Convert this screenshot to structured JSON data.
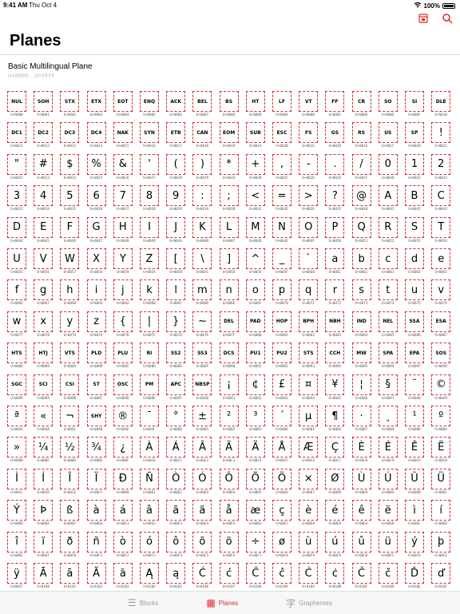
{
  "status": {
    "time": "9:41 AM",
    "date": "Thu Oct 4",
    "battery": "100%"
  },
  "icons": {
    "wifi": "wifi-icon",
    "battery": "battery-icon",
    "bookmark": "bookmark-icon",
    "search": "search-icon",
    "blocks": "blocks-icon",
    "planes": "planes-icon",
    "graphemes": "graphemes-icon"
  },
  "colors": {
    "accent": "#e0282d",
    "dash": "#d52a2a"
  },
  "header": {
    "title": "Planes"
  },
  "plane": {
    "name": "Basic Multilingual Plane",
    "range": "U+0000..U+FFFF"
  },
  "tabs": [
    {
      "label": "Blocks"
    },
    {
      "label": "Planes"
    },
    {
      "label": "Graphemes"
    }
  ]
}
